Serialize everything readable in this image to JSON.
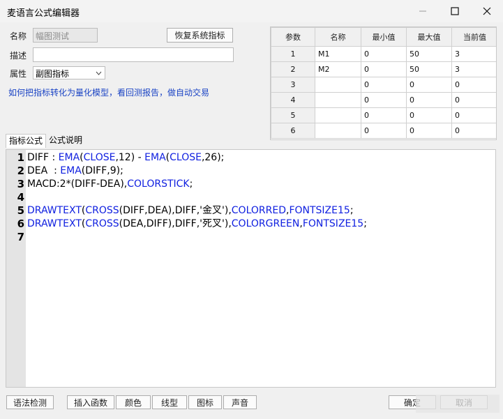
{
  "window": {
    "title": "麦语言公式编辑器"
  },
  "form": {
    "name_label": "名称",
    "name_value": "幅图测试",
    "desc_label": "描述",
    "desc_value": "",
    "attr_label": "属性",
    "attr_value": "副图指标",
    "restore_label": "恢复系统指标",
    "link_text": "如何把指标转化为量化模型，看回测报告，做自动交易"
  },
  "params": {
    "headers": [
      "参数",
      "名称",
      "最小值",
      "最大值",
      "当前值"
    ],
    "rows": [
      [
        "1",
        "M1",
        "0",
        "50",
        "3"
      ],
      [
        "2",
        "M2",
        "0",
        "50",
        "3"
      ],
      [
        "3",
        "",
        "0",
        "0",
        "0"
      ],
      [
        "4",
        "",
        "0",
        "0",
        "0"
      ],
      [
        "5",
        "",
        "0",
        "0",
        "0"
      ],
      [
        "6",
        "",
        "0",
        "0",
        "0"
      ]
    ]
  },
  "tabs": [
    "指标公式",
    "公式说明"
  ],
  "editor": {
    "line_numbers": [
      "1",
      "2",
      "3",
      "4",
      "5",
      "6",
      "7"
    ],
    "lines": [
      [
        {
          "t": "DIFF : ",
          "k": false
        },
        {
          "t": "EMA",
          "k": true
        },
        {
          "t": "(",
          "k": false
        },
        {
          "t": "CLOSE",
          "k": true
        },
        {
          "t": ",12) - ",
          "k": false
        },
        {
          "t": "EMA",
          "k": true
        },
        {
          "t": "(",
          "k": false
        },
        {
          "t": "CLOSE",
          "k": true
        },
        {
          "t": ",26);",
          "k": false
        }
      ],
      [
        {
          "t": "DEA  : ",
          "k": false
        },
        {
          "t": "EMA",
          "k": true
        },
        {
          "t": "(DIFF,9);",
          "k": false
        }
      ],
      [
        {
          "t": "MACD:2*(DIFF-DEA),",
          "k": false
        },
        {
          "t": "COLORSTICK",
          "k": true
        },
        {
          "t": ";",
          "k": false
        }
      ],
      [],
      [
        {
          "t": "DRAWTEXT",
          "k": true
        },
        {
          "t": "(",
          "k": false
        },
        {
          "t": "CROSS",
          "k": true
        },
        {
          "t": "(DIFF,DEA),DIFF,'金叉'),",
          "k": false
        },
        {
          "t": "COLORRED",
          "k": true
        },
        {
          "t": ",",
          "k": false
        },
        {
          "t": "FONTSIZE15",
          "k": true
        },
        {
          "t": ";",
          "k": false
        }
      ],
      [
        {
          "t": "DRAWTEXT",
          "k": true
        },
        {
          "t": "(",
          "k": false
        },
        {
          "t": "CROSS",
          "k": true
        },
        {
          "t": "(DEA,DIFF),DIFF,'死叉'),",
          "k": false
        },
        {
          "t": "COLORGREEN",
          "k": true
        },
        {
          "t": ",",
          "k": false
        },
        {
          "t": "FONTSIZE15",
          "k": true
        },
        {
          "t": ";",
          "k": false
        }
      ],
      []
    ]
  },
  "bottom": {
    "syntax_check": "语法检测",
    "insert_func": "插入函数",
    "color": "颜色",
    "line_type": "线型",
    "icon": "图标",
    "sound": "声音",
    "ok": "确定",
    "cancel": "取消"
  },
  "colors": {
    "keyword": "#1020e0",
    "link": "#1a43c4"
  }
}
